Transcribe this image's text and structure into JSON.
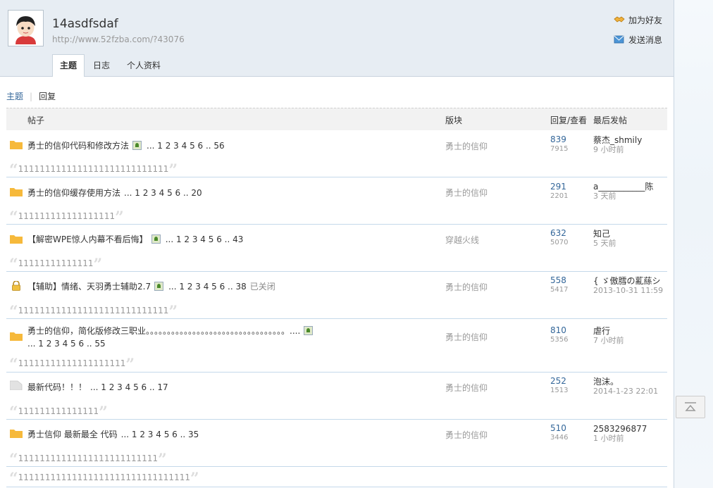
{
  "profile": {
    "username": "14asdfsdaf",
    "url": "http://www.52fzba.com/?43076",
    "actions": {
      "add_friend": "加为好友",
      "send_message": "发送消息"
    }
  },
  "tabs": [
    "主题",
    "日志",
    "个人资料"
  ],
  "subnav": {
    "topics": "主题",
    "replies": "回复"
  },
  "table_head": {
    "post": "帖子",
    "forum": "版块",
    "reply_view": "回复/查看",
    "last_post": "最后发帖"
  },
  "threads": [
    {
      "title": "勇士的信仰代码和修改方法",
      "pages": "... 1 2 3 4 5 6 .. 56",
      "forum": "勇士的信仰",
      "replies": "839",
      "views": "7915",
      "last_author": "蔡杰_shmily",
      "last_time": "9 小时前",
      "quote": "1111111111111111111111111111"
    },
    {
      "title": "勇士的信仰缓存使用方法",
      "pages": "... 1 2 3 4 5 6 .. 20",
      "forum": "勇士的信仰",
      "replies": "291",
      "views": "2201",
      "last_author": "a___________陈",
      "last_time": "3 天前",
      "quote": "111111111111111111"
    },
    {
      "title": "【解密WPE惊人内幕不看后悔】",
      "pages": "... 1 2 3 4 5 6 .. 43",
      "forum": "穿越火线",
      "replies": "632",
      "views": "5070",
      "last_author": "知己",
      "last_time": "5 天前",
      "quote": "11111111111111"
    },
    {
      "title": "【辅助】情绪、天羽勇士辅助2.7",
      "pages": "... 1 2 3 4 5 6 .. 38",
      "closed": "已关闭",
      "forum": "勇士的信仰",
      "replies": "558",
      "views": "5417",
      "last_author": "{ ゞ傲膤の薍蕬シ",
      "last_time": "2013-10-31 11:59",
      "quote": "1111111111111111111111111111"
    },
    {
      "title": "勇士的信仰，简化版修改三职业。。。。。。。。。。。。。。。。。。。。。。。。。。。。。。。。。....",
      "pages": "... 1 2 3 4 5 6 .. 55",
      "forum": "勇士的信仰",
      "replies": "810",
      "views": "5356",
      "last_author": "虐行",
      "last_time": "7 小时前",
      "quote": "11111111111111111111"
    },
    {
      "title": "最新代码！！！",
      "pages": "... 1 2 3 4 5 6 .. 17",
      "forum": "勇士的信仰",
      "replies": "252",
      "views": "1513",
      "last_author": "泡沫。",
      "last_time": "2014-1-23 22:01",
      "quote": "111111111111111"
    },
    {
      "title": "勇士信仰 最新最全 代码",
      "pages": "... 1 2 3 4 5 6 .. 35",
      "forum": "勇士的信仰",
      "replies": "510",
      "views": "3446",
      "last_author": "2583296877",
      "last_time": "1 小时前",
      "quote": "11111111111111111111111111"
    }
  ],
  "trailing_quote": "11111111111111111111111111111111",
  "colors": {
    "accent": "#336699",
    "folder": "#f6b93b",
    "header_bg": "#e7edf3"
  }
}
